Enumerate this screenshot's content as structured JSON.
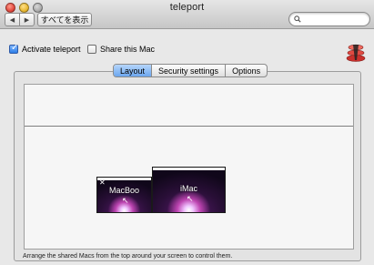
{
  "window": {
    "title": "teleport"
  },
  "toolbar": {
    "back": "◀",
    "forward": "▶",
    "show_all": "すべてを表示",
    "search_placeholder": ""
  },
  "options": {
    "activate": {
      "label": "Activate teleport",
      "checked": true
    },
    "share": {
      "label": "Share this Mac",
      "checked": false
    }
  },
  "tabs": [
    {
      "label": "Layout",
      "active": true
    },
    {
      "label": "Security settings",
      "active": false
    },
    {
      "label": "Options",
      "active": false
    }
  ],
  "layout": {
    "macs": [
      {
        "name": "MacBoo"
      },
      {
        "name": "iMac"
      }
    ],
    "hint": "Arrange the shared Macs from the top around your screen to control them."
  },
  "icons": {
    "logo": "teleport-logo-icon",
    "search": "search-icon",
    "close": "close-icon"
  }
}
